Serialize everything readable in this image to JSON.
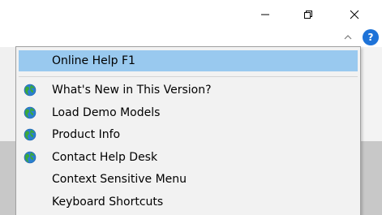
{
  "window": {
    "minimize_icon": "minimize-icon",
    "maximize_icon": "restore-icon",
    "close_icon": "close-icon"
  },
  "toolbar": {
    "collapse_icon": "chevron-up-icon",
    "help_label": "?"
  },
  "menu": {
    "items": [
      {
        "label": "Online Help F1",
        "icon": null,
        "highlighted": true
      },
      {
        "label": "What's New in This Version?",
        "icon": "globe-icon"
      },
      {
        "label": "Load Demo Models",
        "icon": "globe-icon"
      },
      {
        "label": "Product Info",
        "icon": "globe-icon"
      },
      {
        "label": "Contact Help Desk",
        "icon": "globe-icon"
      },
      {
        "label": "Context Sensitive Menu",
        "icon": null
      },
      {
        "label": "Keyboard Shortcuts",
        "icon": null
      }
    ]
  },
  "colors": {
    "highlight": "#99c9ef",
    "help_blue": "#1e73d8",
    "globe_blue": "#2a7fd0",
    "globe_green": "#3aa83a"
  }
}
